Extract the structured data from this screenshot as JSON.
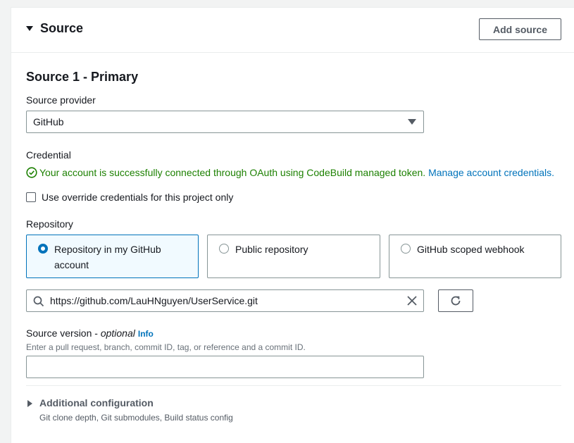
{
  "panel": {
    "title": "Source",
    "add_source_label": "Add source"
  },
  "source": {
    "title": "Source 1 - Primary",
    "provider_label": "Source provider",
    "provider_value": "GitHub",
    "credential_label": "Credential",
    "credential_success": "Your account is successfully connected through OAuth using CodeBuild managed token.",
    "manage_link": "Manage account credentials.",
    "override_label": "Use override credentials for this project only",
    "repository_label": "Repository",
    "repository_options": [
      {
        "label": "Repository in my GitHub account",
        "selected": true
      },
      {
        "label": "Public repository",
        "selected": false
      },
      {
        "label": "GitHub scoped webhook",
        "selected": false
      }
    ],
    "repo_url": "https://github.com/LauHNguyen/UserService.git",
    "version_label": "Source version - ",
    "version_optional": "optional",
    "info_link": "Info",
    "version_hint": "Enter a pull request, branch, commit ID, tag, or reference and a commit ID.",
    "version_value": ""
  },
  "additional": {
    "title": "Additional configuration",
    "description": "Git clone depth, Git submodules, Build status config"
  },
  "colors": {
    "accent": "#0073bb",
    "success": "#1d8102",
    "selected_bg": "#f1faff"
  },
  "icons": [
    "caret-down-icon",
    "check-circle-icon",
    "search-icon",
    "close-icon",
    "refresh-icon",
    "caret-right-icon"
  ]
}
